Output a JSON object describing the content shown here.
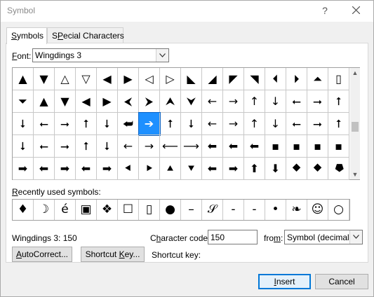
{
  "window": {
    "title": "Symbol",
    "help_glyph": "?"
  },
  "tabs": [
    {
      "label": "Symbols",
      "accel": "S",
      "rest": "ymbols"
    },
    {
      "label": "Special Characters",
      "accel": "P",
      "pre": "S",
      "rest": "ecial Characters"
    }
  ],
  "font": {
    "label": "Font:",
    "label_accel": "F",
    "label_rest": "ont:",
    "value": "Wingdings 3"
  },
  "symbol_grid": {
    "selected_row": 2,
    "selected_col": 6,
    "rows": [
      [
        "▲",
        "▼",
        "△",
        "▽",
        "◀",
        "▶",
        "◁",
        "▷",
        "◣",
        "◢",
        "◤",
        "◥",
        "⏴",
        "⏵",
        "⏶",
        "▯"
      ],
      [
        "⏷",
        "▲",
        "▼",
        "◀",
        "▶",
        "⮜",
        "⮞",
        "⮝",
        "⮟",
        "←",
        "→",
        "↑",
        "↓",
        "⭠",
        "⭢",
        "⭡"
      ],
      [
        "⭣",
        "⭠",
        "⭢",
        "⭡",
        "⭣",
        "⮨",
        "➔",
        "⭡",
        "⭣",
        "←",
        "→",
        "↑",
        "↓",
        "⭠",
        "⭢",
        "⭡"
      ],
      [
        "⭣",
        "⭠",
        "⭢",
        "⭡",
        "⭣",
        "←",
        "→",
        "⟵",
        "⟶",
        "⬅",
        "⬅",
        "⬅",
        "▪",
        "▪",
        "▪",
        "▪"
      ],
      [
        "➡",
        "⬅",
        "➡",
        "⬅",
        "➡",
        "⯇",
        "⯈",
        "⯅",
        "⯆",
        "⬅",
        "➡",
        "⬆",
        "⬇",
        "⯁",
        "⯁",
        "⯂"
      ]
    ]
  },
  "recently_used": {
    "label": "Recently used symbols:",
    "label_accel": "R",
    "label_rest": "ecently used symbols:",
    "symbols": [
      "♦",
      "☽",
      "é",
      "▣",
      "❖",
      "☐",
      "▯",
      "●",
      "–",
      "𝒮",
      "-",
      "-",
      "•",
      "❧",
      "☺",
      "○"
    ]
  },
  "character_info": {
    "name_readout": "Wingdings 3: 150",
    "code_label": "Character code:",
    "code_label_pre": "C",
    "code_label_accel": "h",
    "code_label_rest": "aracter code:",
    "code_value": "150",
    "from_label": "from:",
    "from_label_pre": "fro",
    "from_label_accel": "m",
    "from_label_rest": ":",
    "from_value": "Symbol (decimal)"
  },
  "buttons": {
    "autocorrect": "AutoCorrect...",
    "autocorrect_accel": "A",
    "autocorrect_rest": "utoCorrect...",
    "shortcut_key": "Shortcut Key...",
    "shortcut_key_pre": "Shortcut ",
    "shortcut_key_accel": "K",
    "shortcut_key_rest": "ey...",
    "shortcut_key_label": "Shortcut key:",
    "insert": "Insert",
    "insert_accel": "I",
    "insert_rest": "nsert",
    "cancel": "Cancel"
  },
  "colors": {
    "selection": "#1e90ff",
    "default_button_border": "#0078d7"
  }
}
